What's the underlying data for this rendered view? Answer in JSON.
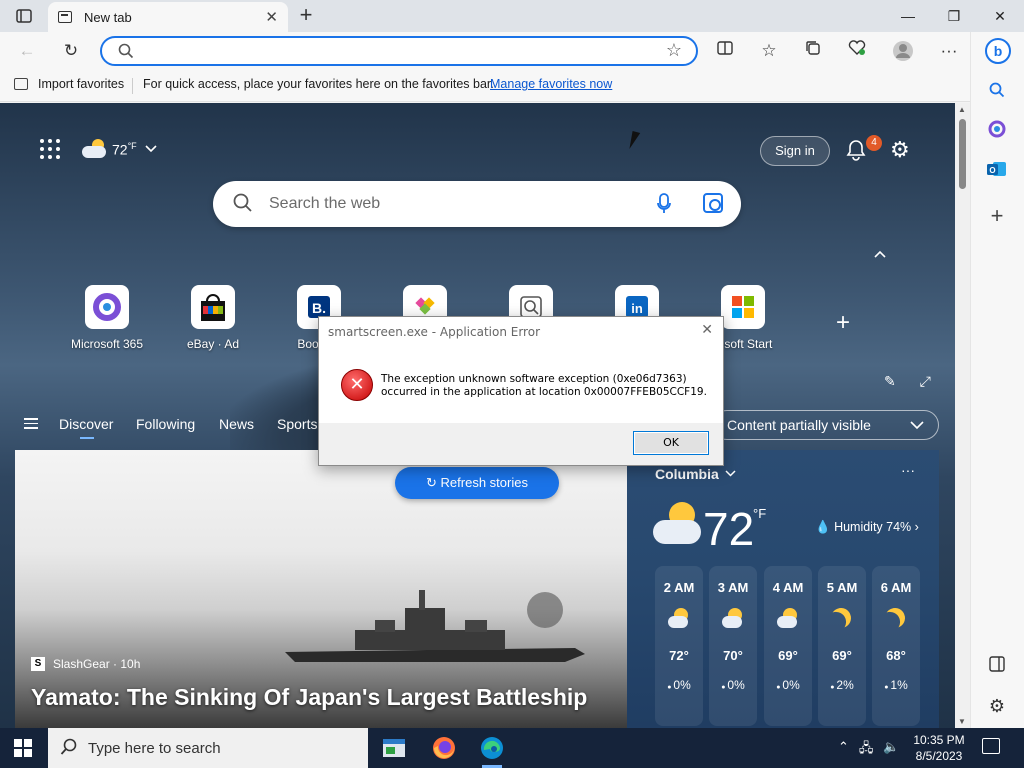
{
  "browser": {
    "tab_title": "New tab",
    "address_placeholder": "",
    "favorites_bar": {
      "import_label": "Import favorites",
      "hint": "For quick access, place your favorites here on the favorites bar.",
      "manage_link": "Manage favorites now"
    }
  },
  "newtab": {
    "weather_top": {
      "temp": "72",
      "unit": "°F"
    },
    "sign_in": "Sign in",
    "notification_count": "4",
    "search_placeholder": "Search the web",
    "tiles": [
      {
        "label": "Microsoft 365"
      },
      {
        "label": "eBay · Ad"
      },
      {
        "label": "Booking"
      },
      {
        "label": ""
      },
      {
        "label": ""
      },
      {
        "label": ""
      },
      {
        "label": "rosoft Start"
      }
    ],
    "feed_nav": [
      "Discover",
      "Following",
      "News",
      "Sports"
    ],
    "content_visibility": "Content partially visible",
    "refresh_label": "Refresh stories",
    "story": {
      "source": "SlashGear · 10h",
      "headline": "Yamato: The Sinking Of Japan's Largest Battleship"
    },
    "weather": {
      "location": "Columbia",
      "temp": "72",
      "unit": "°F",
      "humidity": "Humidity 74%",
      "hours": [
        {
          "time": "2 AM",
          "temp": "72°",
          "rain": "0%",
          "icon": "partly-cloudy-night"
        },
        {
          "time": "3 AM",
          "temp": "70°",
          "rain": "0%",
          "icon": "partly-cloudy-night"
        },
        {
          "time": "4 AM",
          "temp": "69°",
          "rain": "0%",
          "icon": "partly-cloudy-night"
        },
        {
          "time": "5 AM",
          "temp": "69°",
          "rain": "2%",
          "icon": "moon"
        },
        {
          "time": "6 AM",
          "temp": "68°",
          "rain": "1%",
          "icon": "moon"
        }
      ]
    }
  },
  "dialog": {
    "title": "smartscreen.exe - Application Error",
    "message_line1": "The exception unknown software exception (0xe06d7363)",
    "message_line2": "occurred in the application at location 0x00007FFEB05CCF19.",
    "ok_label": "OK"
  },
  "taskbar": {
    "search_placeholder": "Type here to search",
    "time": "10:35 PM",
    "date": "8/5/2023"
  },
  "colors": {
    "accent": "#1a73e8",
    "error_red": "#c40000",
    "taskbar": "#15233a",
    "weather_card": "#2b4c73"
  }
}
